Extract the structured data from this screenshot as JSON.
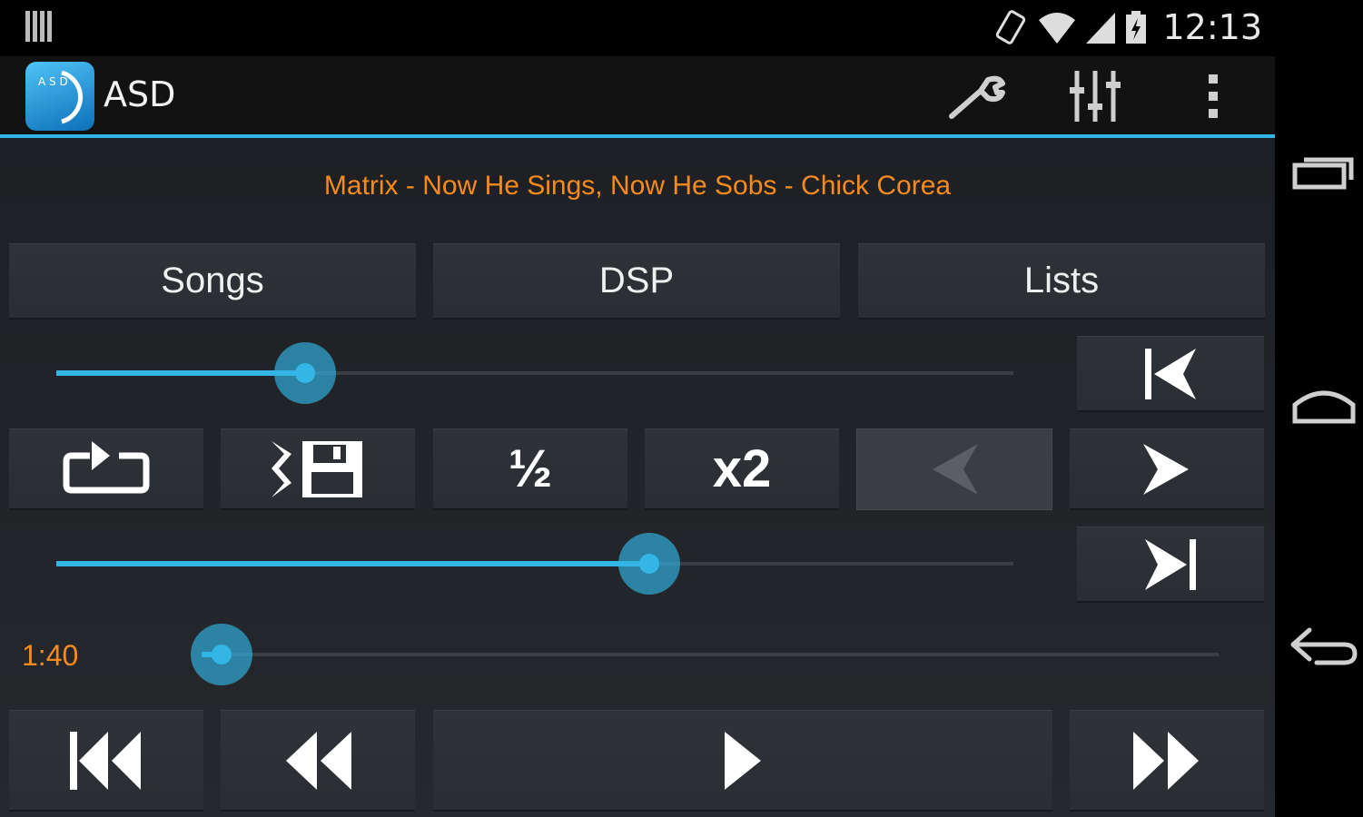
{
  "status_bar": {
    "time": "12:13",
    "icons": [
      "notification-bars-icon",
      "rotate-phone-icon",
      "wifi-icon",
      "cell-signal-icon",
      "battery-charging-icon"
    ]
  },
  "action_bar": {
    "title": "ASD",
    "logo_letters": "ASD",
    "actions": [
      "wrench-icon",
      "equalizer-icon",
      "overflow-menu-icon"
    ]
  },
  "now_playing": "Matrix - Now He Sings, Now He Sobs - Chick Corea",
  "tabs": [
    {
      "label": "Songs"
    },
    {
      "label": "DSP"
    },
    {
      "label": "Lists"
    }
  ],
  "controls": {
    "half_label": "½",
    "double_label": "x2"
  },
  "sliders": {
    "speed": 0.26,
    "pitch": 0.62,
    "position": 0.02
  },
  "position_time": "1:40",
  "colors": {
    "accent": "#33b5e5",
    "now_playing": "#f58b1f",
    "background": "#1d2024"
  },
  "nav_bar": [
    "recent-apps-icon",
    "home-icon",
    "back-icon"
  ]
}
